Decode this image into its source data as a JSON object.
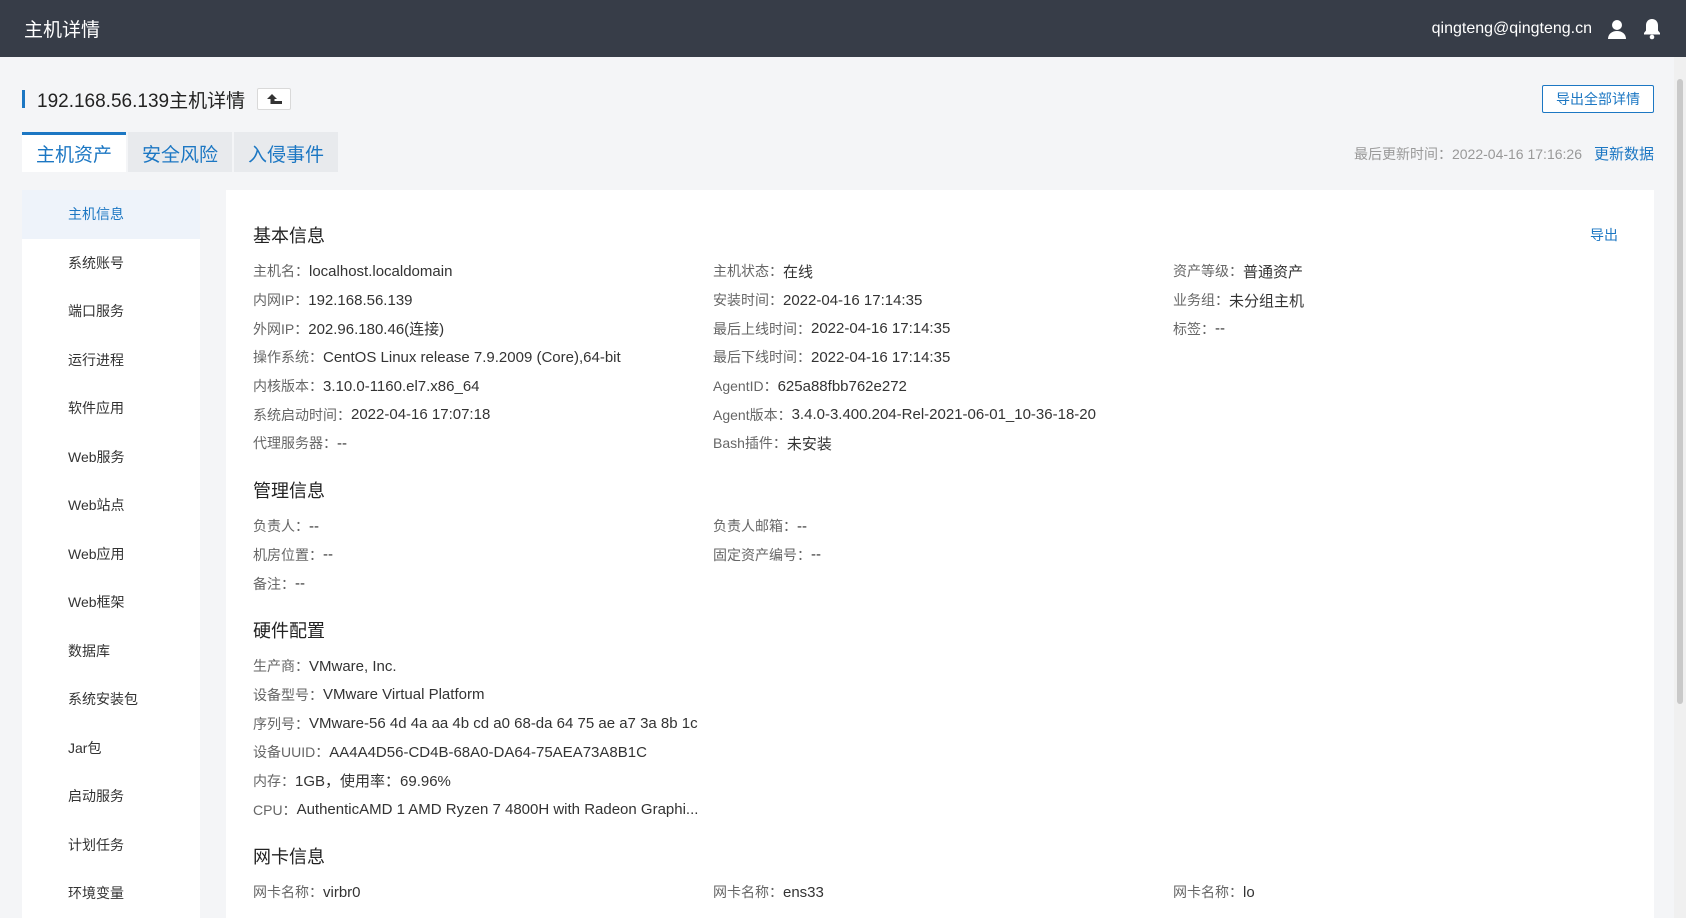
{
  "app": {
    "title": "主机详情",
    "user_email": "qingteng@qingteng.cn"
  },
  "colors": {
    "accent": "#1c77c3",
    "topbar": "#373d48"
  },
  "header": {
    "page_title": "192.168.56.139主机详情",
    "export_all_label": "导出全部详情"
  },
  "tabs": [
    {
      "label": "主机资产",
      "active": true
    },
    {
      "label": "安全风险",
      "active": false
    },
    {
      "label": "入侵事件",
      "active": false
    }
  ],
  "update": {
    "label": "最后更新时间：2022-04-16 17:16:26",
    "refresh_label": "更新数据"
  },
  "sidebar": {
    "items": [
      {
        "label": "主机信息",
        "active": true
      },
      {
        "label": "系统账号"
      },
      {
        "label": "端口服务"
      },
      {
        "label": "运行进程"
      },
      {
        "label": "软件应用"
      },
      {
        "label": "Web服务"
      },
      {
        "label": "Web站点"
      },
      {
        "label": "Web应用"
      },
      {
        "label": "Web框架"
      },
      {
        "label": "数据库"
      },
      {
        "label": "系统安装包"
      },
      {
        "label": "Jar包"
      },
      {
        "label": "启动服务"
      },
      {
        "label": "计划任务"
      },
      {
        "label": "环境变量"
      }
    ]
  },
  "basic": {
    "title": "基本信息",
    "export_label": "导出",
    "col1": [
      {
        "label": "主机名：",
        "value": "localhost.localdomain"
      },
      {
        "label": "内网IP：",
        "value": "192.168.56.139"
      },
      {
        "label": "外网IP：",
        "value": "202.96.180.46(连接)"
      },
      {
        "label": "操作系统：",
        "value": "CentOS Linux release 7.9.2009 (Core),64-bit"
      },
      {
        "label": "内核版本：",
        "value": "3.10.0-1160.el7.x86_64"
      },
      {
        "label": "系统启动时间：",
        "value": "2022-04-16 17:07:18"
      },
      {
        "label": "代理服务器：",
        "value": "--"
      }
    ],
    "col2": [
      {
        "label": "主机状态：",
        "value": "在线"
      },
      {
        "label": "安装时间：",
        "value": "2022-04-16 17:14:35"
      },
      {
        "label": "最后上线时间：",
        "value": "2022-04-16 17:14:35"
      },
      {
        "label": "最后下线时间：",
        "value": "2022-04-16 17:14:35"
      },
      {
        "label": "AgentID：",
        "value": "625a88fbb762e272"
      },
      {
        "label": "Agent版本：",
        "value": "3.4.0-3.400.204-Rel-2021-06-01_10-36-18-20"
      },
      {
        "label": "Bash插件：",
        "value": "未安装"
      }
    ],
    "col3": [
      {
        "label": "资产等级：",
        "value": "普通资产"
      },
      {
        "label": "业务组：",
        "value": "未分组主机"
      },
      {
        "label": "标签：",
        "value": "--"
      }
    ]
  },
  "management": {
    "title": "管理信息",
    "col1": [
      {
        "label": "负责人：",
        "value": "--"
      },
      {
        "label": "机房位置：",
        "value": "--"
      },
      {
        "label": "备注：",
        "value": "--"
      }
    ],
    "col2": [
      {
        "label": "负责人邮箱：",
        "value": "--"
      },
      {
        "label": "固定资产编号：",
        "value": "--"
      }
    ]
  },
  "hardware": {
    "title": "硬件配置",
    "rows": [
      {
        "label": "生产商：",
        "value": "VMware, Inc."
      },
      {
        "label": "设备型号：",
        "value": "VMware Virtual Platform"
      },
      {
        "label": "序列号：",
        "value": "VMware-56 4d 4a aa 4b cd a0 68-da 64 75 ae a7 3a 8b 1c"
      },
      {
        "label": "设备UUID：",
        "value": "AA4A4D56-CD4B-68A0-DA64-75AEA73A8B1C"
      },
      {
        "label": "内存：",
        "value": "1GB，使用率：69.96%"
      },
      {
        "label": "CPU：",
        "value": "AuthenticAMD 1 AMD Ryzen 7 4800H with Radeon Graphi..."
      }
    ]
  },
  "nic": {
    "title": "网卡信息",
    "items": [
      {
        "label": "网卡名称：",
        "value": "virbr0"
      },
      {
        "label": "网卡名称：",
        "value": "ens33"
      },
      {
        "label": "网卡名称：",
        "value": "lo"
      }
    ]
  }
}
